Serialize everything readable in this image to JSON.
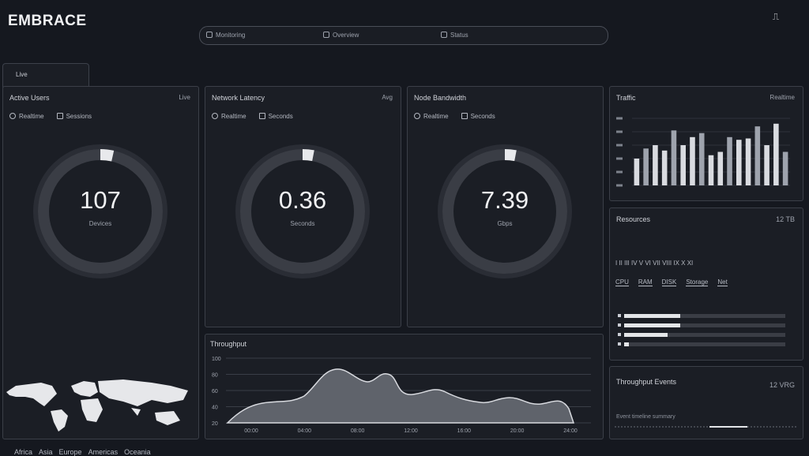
{
  "header": {
    "brand": "EMBRACE",
    "icon": "notification-icon"
  },
  "topbar": {
    "segments": [
      "Monitoring",
      "Overview",
      "Status"
    ]
  },
  "tab": {
    "label": "Live"
  },
  "gauges": [
    {
      "title": "Active Users",
      "right": "Live",
      "legend_a": "Realtime",
      "legend_b": "Sessions",
      "value": "107",
      "unit": "Devices",
      "fill": 0.07
    },
    {
      "title": "Network Latency",
      "right": "Avg",
      "legend_a": "Realtime",
      "legend_b": "Seconds",
      "value": "0.36",
      "unit": "Seconds",
      "fill": 0.06
    },
    {
      "title": "Node Bandwidth",
      "right": "",
      "legend_a": "Realtime",
      "legend_b": "Seconds",
      "value": "7.39",
      "unit": "Gbps",
      "fill": 0.06
    }
  ],
  "map": {
    "labels": [
      "Africa",
      "Asia",
      "Europe",
      "Americas",
      "Oceania"
    ]
  },
  "bars_panel": {
    "title": "Traffic",
    "right": "Realtime",
    "values": [
      40,
      55,
      60,
      52,
      82,
      60,
      72,
      78,
      45,
      50,
      72,
      68,
      70,
      88,
      60,
      92,
      50
    ]
  },
  "stats_panel": {
    "title": "Resources",
    "right": "12 TB",
    "row1": "I  II  III  IV  V  VI  VII  VIII  IX  X  XI",
    "row2": [
      "CPU",
      "RAM",
      "DISK",
      "Storage",
      "Net"
    ],
    "bars": [
      0.35,
      0.35,
      0.27,
      0.03
    ]
  },
  "area_panel": {
    "title": "Throughput",
    "yticks": [
      "100",
      "80",
      "60",
      "40",
      "20"
    ],
    "xticks": [
      "00:00",
      "04:00",
      "08:00",
      "12:00",
      "16:00",
      "20:00",
      "24:00"
    ]
  },
  "bottom_panel": {
    "title": "Throughput Events",
    "right": "12 VRG",
    "caption": "Event timeline summary"
  }
}
